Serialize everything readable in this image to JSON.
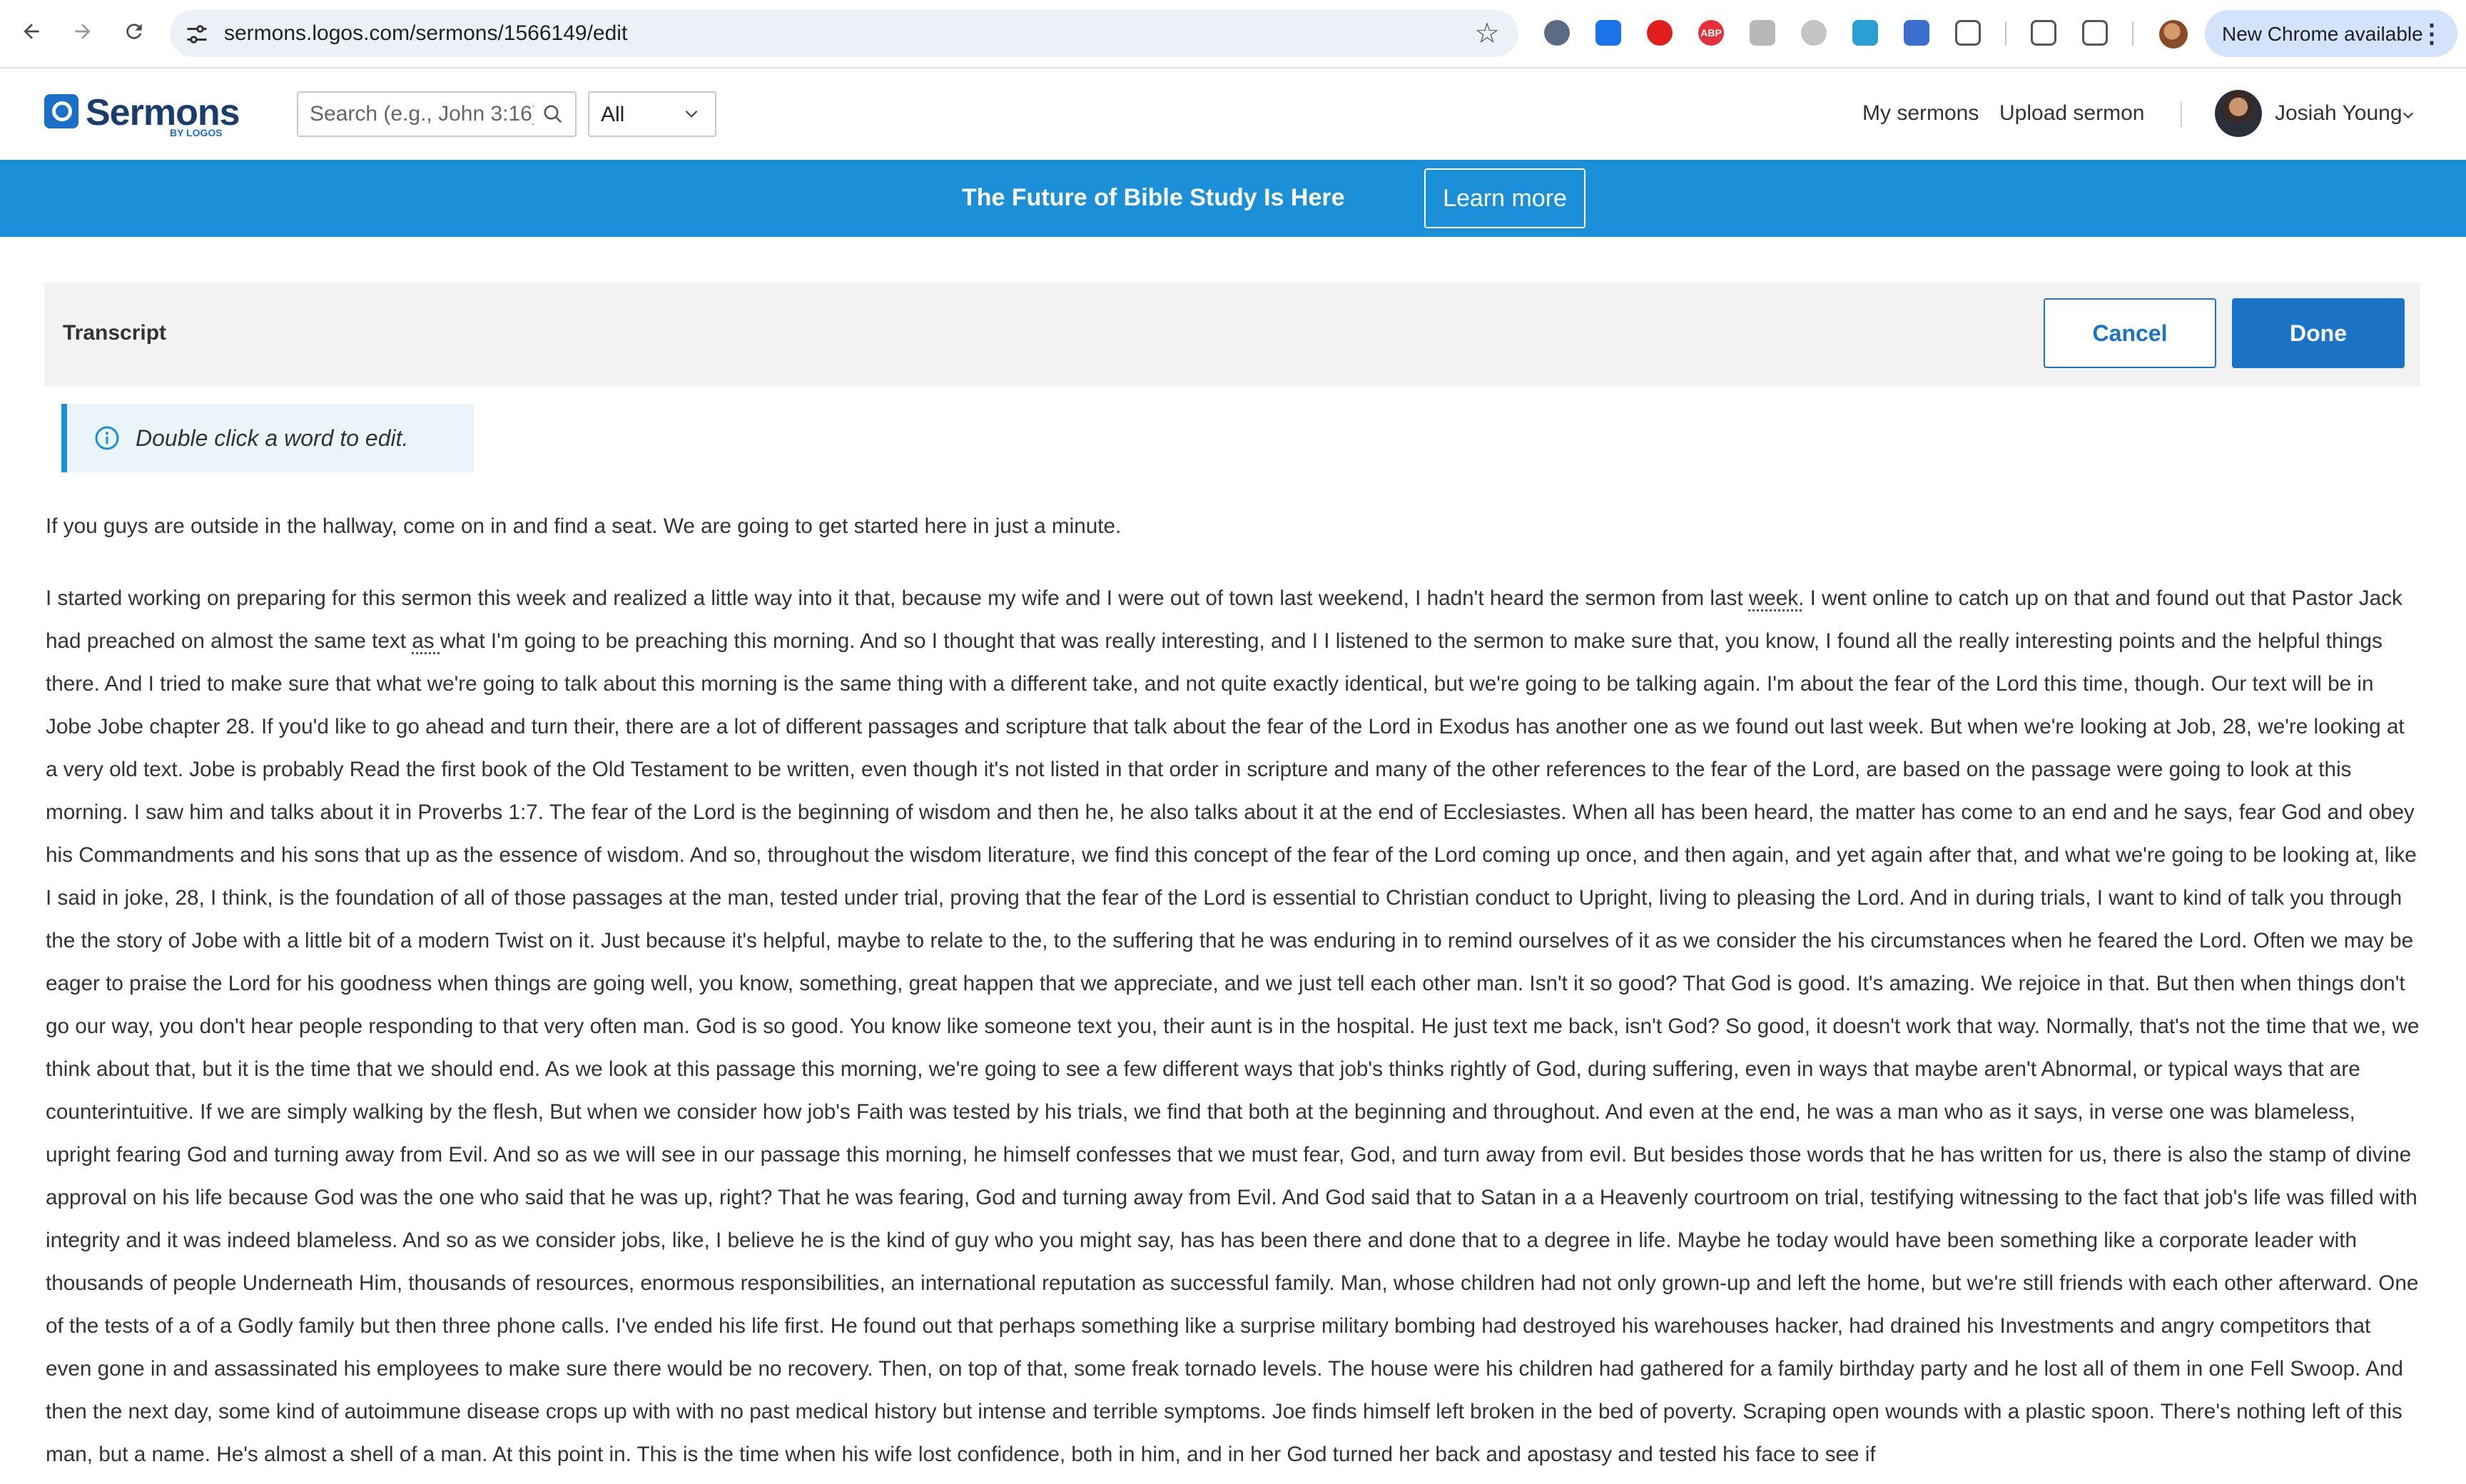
{
  "browser": {
    "url": "sermons.logos.com/sermons/1566149/edit",
    "update_label": "New Chrome available"
  },
  "header": {
    "logo_text": "Sermons",
    "logo_sub": "BY LOGOS",
    "search": {
      "placeholder": "Search (e.g., John 3:16)"
    },
    "scope": {
      "selected": "All"
    },
    "links": {
      "my_sermons": "My sermons",
      "upload_sermon": "Upload sermon"
    },
    "user": {
      "name": "Josiah Young"
    }
  },
  "banner": {
    "text": "The Future of Bible Study Is Here",
    "button": "Learn more"
  },
  "transcript_toolbar": {
    "title": "Transcript",
    "cancel": "Cancel",
    "done": "Done"
  },
  "hint": {
    "text": "Double click a word to edit."
  },
  "transcript": {
    "paragraph_1": "If you guys are outside in the hallway, come on in and find a seat. We are going to get started here in just a minute.",
    "paragraph_2": {
      "part_1": "I started working on preparing for this sermon this week and realized a little way into it that, because my wife and I were out of town last weekend, I hadn't heard the sermon from last ",
      "edited_1": "week.",
      "part_2": " I went online to catch up on that and found out that Pastor Jack had preached on almost the same text ",
      "edited_2": "as ",
      "part_3": "what I'm going to be preaching this morning. And so I thought that was really interesting, and I I listened to the sermon to make sure that, you know, I found all the really interesting points and the helpful things there. And I tried to make sure that what we're going to talk about this morning is the same thing with a different take, and not quite exactly identical, but we're going to be talking again. I'm about the fear of the Lord this time, though. Our text will be in Jobe Jobe chapter 28. If you'd like to go ahead and turn their, there are a lot of different passages and scripture that talk about the fear of the Lord in Exodus has another one as we found out last week. But when we're looking at Job, 28, we're looking at a very old text. Jobe is probably Read the first book of the Old Testament to be written, even though it's not listed in that order in scripture and many of the other references to the fear of the Lord, are based on the passage were going to look at this morning. I saw him and talks about it in Proverbs 1:7. The fear of the Lord is the beginning of wisdom and then he, he also talks about it at the end of Ecclesiastes. When all has been heard, the matter has come to an end and he says, fear God and obey his Commandments and his sons that up as the essence of wisdom. And so, throughout the wisdom literature, we find this concept of the fear of the Lord coming up once, and then again, and yet again after that, and what we're going to be looking at, like I said in joke, 28, I think, is the foundation of all of those passages at the man, tested under trial, proving that the fear of the Lord is essential to Christian conduct to Upright, living to pleasing the Lord. And in during trials, I want to kind of talk you through the the story of Jobe with a little bit of a modern Twist on it. Just because it's helpful, maybe to relate to the, to the suffering that he was enduring in to remind ourselves of it as we consider the his circumstances when he feared the Lord. Often we may be eager to praise the Lord for his goodness when things are going well, you know, something, great happen that we appreciate, and we just tell each other man. Isn't it so good? That God is good. It's amazing. We rejoice in that. But then when things don't go our way, you don't hear people responding to that very often man. God is so good. You know like someone text you, their aunt is in the hospital. He just text me back, isn't God? So good, it doesn't work that way. Normally, that's not the time that we, we think about that, but it is the time that we should end. As we look at this passage this morning, we're going to see a few different ways that job's thinks rightly of God, during suffering, even in ways that maybe aren't Abnormal, or typical ways that are counterintuitive. If we are simply walking by the flesh, But when we consider how job's Faith was tested by his trials, we find that both at the beginning and throughout. And even at the end, he was a man who as it says, in verse one was blameless, upright fearing God and turning away from Evil. And so as we will see in our passage this morning, he himself confesses that we must fear, God, and turn away from evil. But besides those words that he has written for us, there is also the stamp of divine approval on his life because God was the one who said that he was up, right? That he was fearing, God and turning away from Evil. And God said that to Satan in a a Heavenly courtroom on trial, testifying witnessing to the fact that job's life was filled with integrity and it was indeed blameless. And so as we consider jobs, like, I believe he is the kind of guy who you might say, has has been there and done that to a degree in life. Maybe he today would have been something like a corporate leader with thousands of people Underneath Him, thousands of resources, enormous responsibilities, an international reputation as successful family. Man, whose children had not only grown-up and left the home, but we're still friends with each other afterward. One of the tests of a of a Godly family but then three phone calls. I've ended his life first. He found out that perhaps something like a surprise military bombing had destroyed his warehouses hacker, had drained his Investments and angry competitors that even gone in and assassinated his employees to make sure there would be no recovery. Then, on top of that, some freak tornado levels. The house were his children had gathered for a family birthday party and he lost all of them in one Fell Swoop. And then the next day, some kind of autoimmune disease crops up with with no past medical history but intense and terrible symptoms. Joe finds himself left broken in the bed of poverty. Scraping open wounds with a plastic spoon. There's nothing left of this man, but a name. He's almost a shell of a man. At this point in. This is the time when his wife lost confidence, both in him, and in her God turned her back and apostasy and tested his face to see if"
    }
  },
  "colors": {
    "brand_blue": "#1a73c4",
    "banner_blue": "#1c8fd9",
    "toolbar_bg": "#f2f2f2",
    "hint_bg": "#e9f5fb"
  },
  "icons": [
    "back-arrow-icon",
    "forward-arrow-icon",
    "reload-icon",
    "site-settings-icon",
    "bookmark-star-icon",
    "extensions-icon",
    "search-icon",
    "chevron-down-icon",
    "info-icon"
  ]
}
